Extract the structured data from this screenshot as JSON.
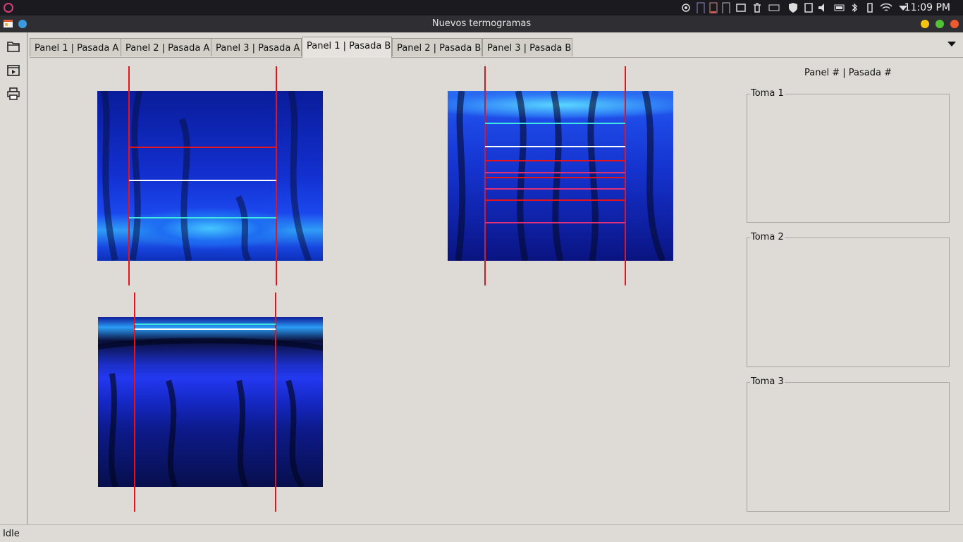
{
  "system_bar": {
    "clock": "11:09 PM"
  },
  "window": {
    "title": "Nuevos termogramas"
  },
  "tabs": [
    {
      "label": "Panel 1 | Pasada A",
      "active": false
    },
    {
      "label": "Panel 2 | Pasada A",
      "active": false
    },
    {
      "label": "Panel 3 | Pasada A",
      "active": false
    },
    {
      "label": "Panel 1 | Pasada B",
      "active": true
    },
    {
      "label": "Panel 2 | Pasada B",
      "active": false
    },
    {
      "label": "Panel 3 | Pasada B",
      "active": false
    }
  ],
  "side_panel": {
    "header": "Panel # | Pasada #",
    "groups": [
      {
        "label": "Toma 1"
      },
      {
        "label": "Toma 2"
      },
      {
        "label": "Toma 3"
      }
    ]
  },
  "status": {
    "text": "Idle"
  },
  "colors": {
    "marker_line": "#e4141a",
    "cyan_line": "#3fe6e0",
    "white_line": "#ffffff",
    "pink_line": "#e0307a"
  }
}
